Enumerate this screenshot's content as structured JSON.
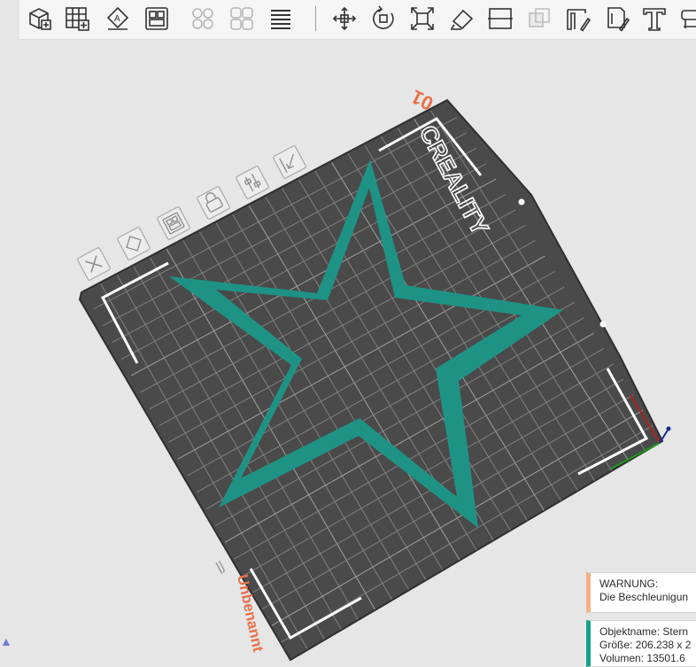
{
  "toolbar": {
    "buttons": [
      {
        "name": "add-object-button",
        "icon": "cube-add-icon"
      },
      {
        "name": "add-plate-button",
        "icon": "grid-add-icon"
      },
      {
        "name": "auto-orient-button",
        "icon": "orient-icon"
      },
      {
        "name": "arrange-button",
        "icon": "arrange-icon"
      },
      {
        "name": "split-objects-button",
        "icon": "split-objects-icon"
      },
      {
        "name": "split-parts-button",
        "icon": "split-parts-icon"
      },
      {
        "name": "layers-button",
        "icon": "layers-icon"
      },
      {
        "name": "move-tool-button",
        "icon": "move-icon"
      },
      {
        "name": "rotate-tool-button",
        "icon": "rotate-icon"
      },
      {
        "name": "scale-tool-button",
        "icon": "scale-icon"
      },
      {
        "name": "lay-on-face-button",
        "icon": "lay-on-face-icon"
      },
      {
        "name": "cut-tool-button",
        "icon": "cut-icon"
      },
      {
        "name": "boolean-tool-button",
        "icon": "boolean-icon"
      },
      {
        "name": "support-paint-button",
        "icon": "support-paint-icon"
      },
      {
        "name": "seam-paint-button",
        "icon": "seam-paint-icon"
      },
      {
        "name": "text-tool-button",
        "icon": "text-icon"
      },
      {
        "name": "measure-tool-button",
        "icon": "measure-icon"
      }
    ]
  },
  "plate": {
    "number": "01",
    "brand": "CREALITY",
    "name": "Unbenannt",
    "model_color": "#1e9385",
    "bed_color": "#4a4a4a"
  },
  "plate_tools": [
    {
      "name": "delete-plate-button",
      "icon": "close-icon"
    },
    {
      "name": "orient-plate-button",
      "icon": "orient-icon"
    },
    {
      "name": "arrange-plate-button",
      "icon": "arrange-icon"
    },
    {
      "name": "lock-plate-button",
      "icon": "lock-icon"
    },
    {
      "name": "plate-settings-button",
      "icon": "settings-sliders-icon"
    },
    {
      "name": "plate-home-button",
      "icon": "collapse-arrow-icon"
    }
  ],
  "warning": {
    "title": "WARNUNG:",
    "message": "Die Beschleunigun",
    "accent": "#f4b183"
  },
  "object_info": {
    "name_line": "Objektname: Stern",
    "size_line": "Größe: 206.238 x 2",
    "volume_line": "Volumen: 13501.6",
    "accent": "#14a08e"
  }
}
